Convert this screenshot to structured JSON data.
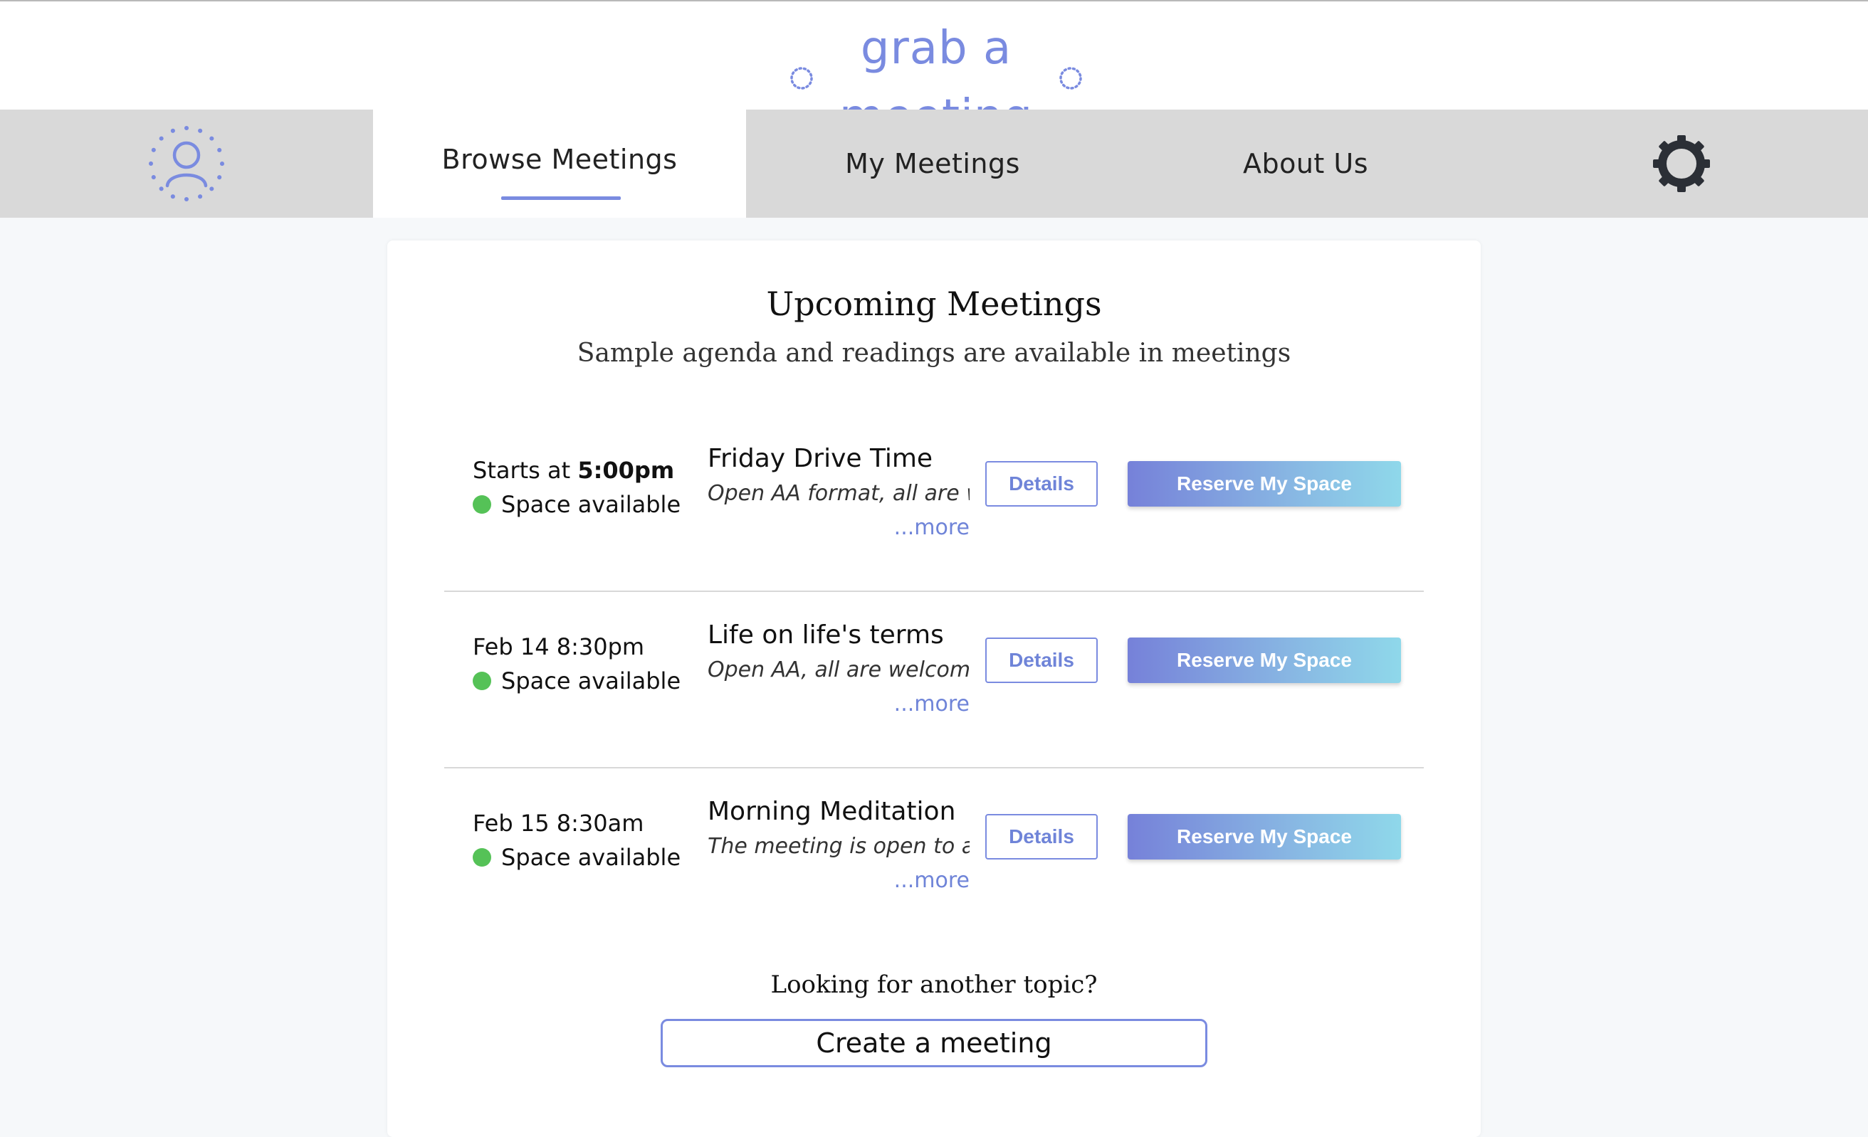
{
  "brand": {
    "logo_text": "grab a meeting",
    "accent_color": "#7a8be0"
  },
  "nav": {
    "profile_icon": "user-icon",
    "tabs": [
      {
        "label": "Browse Meetings",
        "active": true
      },
      {
        "label": "My Meetings",
        "active": false
      },
      {
        "label": "About Us",
        "active": false
      }
    ],
    "settings_icon": "gear-icon"
  },
  "main": {
    "title": "Upcoming Meetings",
    "subtitle": "Sample agenda and readings are available in meetings",
    "meetings": [
      {
        "when_prefix": "Starts at ",
        "when_time": "5:00pm",
        "availability": "Space available",
        "title": "Friday Drive Time",
        "description": "Open AA format, all are w",
        "more": "...more",
        "details_label": "Details",
        "reserve_label": "Reserve My Space"
      },
      {
        "when": "Feb 14 8:30pm",
        "availability": "Space available",
        "title": "Life on life's terms",
        "description": "Open AA, all are welcome.",
        "more": "...more",
        "details_label": "Details",
        "reserve_label": "Reserve My Space"
      },
      {
        "when": "Feb 15 8:30am",
        "availability": "Space available",
        "title": "Morning Meditation",
        "description": "The meeting is open to al",
        "more": "...more",
        "details_label": "Details",
        "reserve_label": "Reserve My Space"
      }
    ],
    "another_topic": "Looking for another topic?",
    "create_label": "Create a meeting"
  },
  "colors": {
    "available": "#55c257",
    "nav_bg": "#d9d9d9",
    "page_bg": "#f6f8fa"
  }
}
